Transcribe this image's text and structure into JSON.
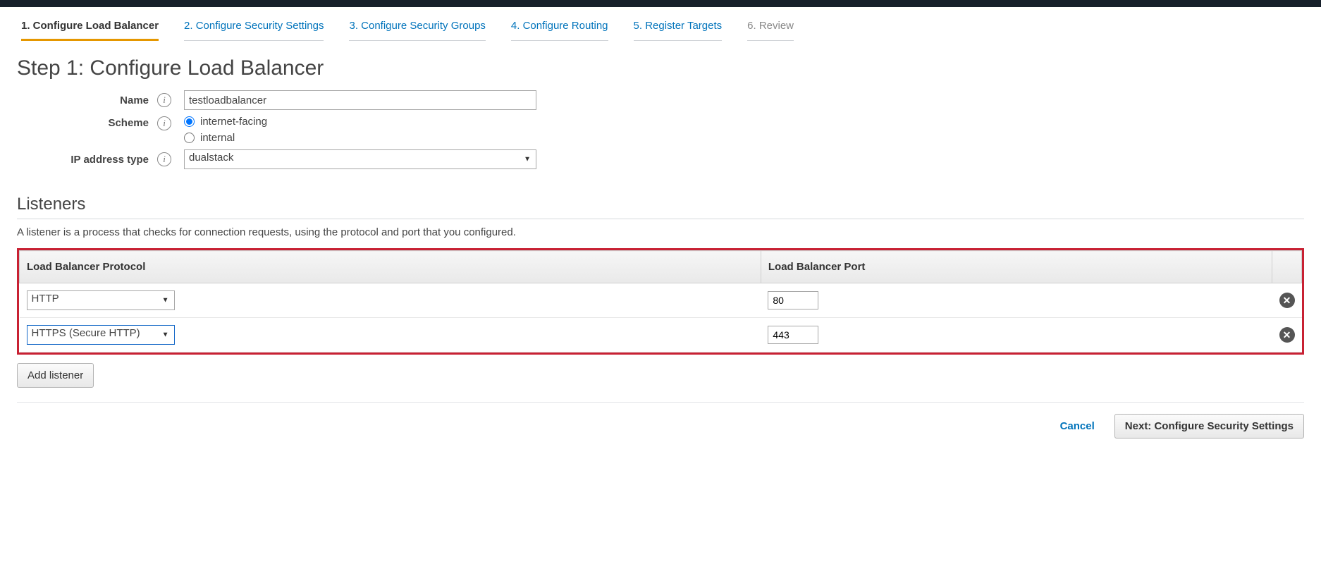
{
  "wizard": {
    "tabs": [
      {
        "label": "1. Configure Load Balancer",
        "state": "active"
      },
      {
        "label": "2. Configure Security Settings",
        "state": "link"
      },
      {
        "label": "3. Configure Security Groups",
        "state": "link"
      },
      {
        "label": "4. Configure Routing",
        "state": "link"
      },
      {
        "label": "5. Register Targets",
        "state": "link"
      },
      {
        "label": "6. Review",
        "state": "disabled"
      }
    ]
  },
  "step": {
    "title": "Step 1: Configure Load Balancer"
  },
  "form": {
    "name_label": "Name",
    "name_value": "testloadbalancer",
    "scheme_label": "Scheme",
    "scheme_options": {
      "internet_facing": "internet-facing",
      "internal": "internal"
    },
    "scheme_selected": "internet-facing",
    "ip_type_label": "IP address type",
    "ip_type_value": "dualstack"
  },
  "listeners": {
    "section_title": "Listeners",
    "description": "A listener is a process that checks for connection requests, using the protocol and port that you configured.",
    "columns": {
      "protocol": "Load Balancer Protocol",
      "port": "Load Balancer Port"
    },
    "rows": [
      {
        "protocol": "HTTP",
        "port": "80",
        "selected": false
      },
      {
        "protocol": "HTTPS (Secure HTTP)",
        "port": "443",
        "selected": true
      }
    ],
    "add_button": "Add listener"
  },
  "footer": {
    "cancel": "Cancel",
    "next": "Next: Configure Security Settings"
  },
  "icons": {
    "info": "i",
    "remove": "✕"
  }
}
